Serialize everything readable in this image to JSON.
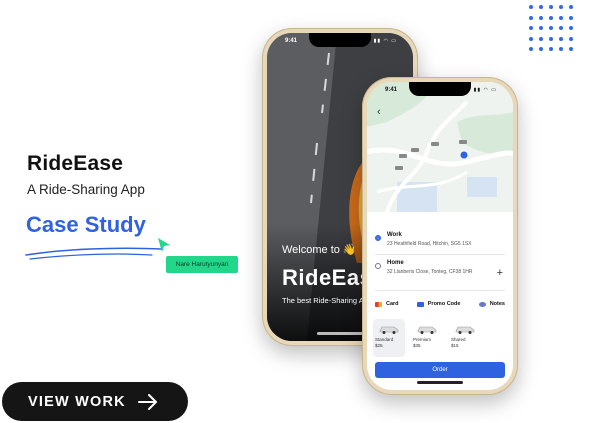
{
  "left": {
    "brand": "RideEase",
    "tagline": "A Ride-Sharing App",
    "case_label": "Case Study",
    "author_tag": "Nare Harutyunyan",
    "cta_label": "VIEW WORK",
    "cta_icon": "arrow-right-icon"
  },
  "phone_welcome": {
    "time": "9:41",
    "welcome": "Welcome to 👋",
    "brand": "RideEase",
    "subtitle": "The best Ride-Sharing App"
  },
  "phone_order": {
    "time": "9:41",
    "destinations": [
      {
        "title": "Work",
        "address": "23 Heathfield Road, Hitchin, SG5 1SX"
      },
      {
        "title": "Home",
        "address": "32 Llanberis Close, Tonteg, CF38 1HR"
      }
    ],
    "payment": [
      {
        "label": "Card",
        "icon": "card-icon"
      },
      {
        "label": "Promo Code",
        "icon": "promo-icon"
      },
      {
        "label": "Notes",
        "icon": "notes-icon"
      }
    ],
    "rides": [
      {
        "name": "Standard",
        "price": "$25",
        "selected": true
      },
      {
        "name": "Premium",
        "price": "$35",
        "selected": false
      },
      {
        "name": "Shared",
        "price": "$15",
        "selected": false
      }
    ],
    "order_label": "Order"
  },
  "colors": {
    "accent": "#2f62e0",
    "author_badge": "#22d68a",
    "cta_bg": "#151515",
    "phone_frame": "#e7d8b9"
  }
}
